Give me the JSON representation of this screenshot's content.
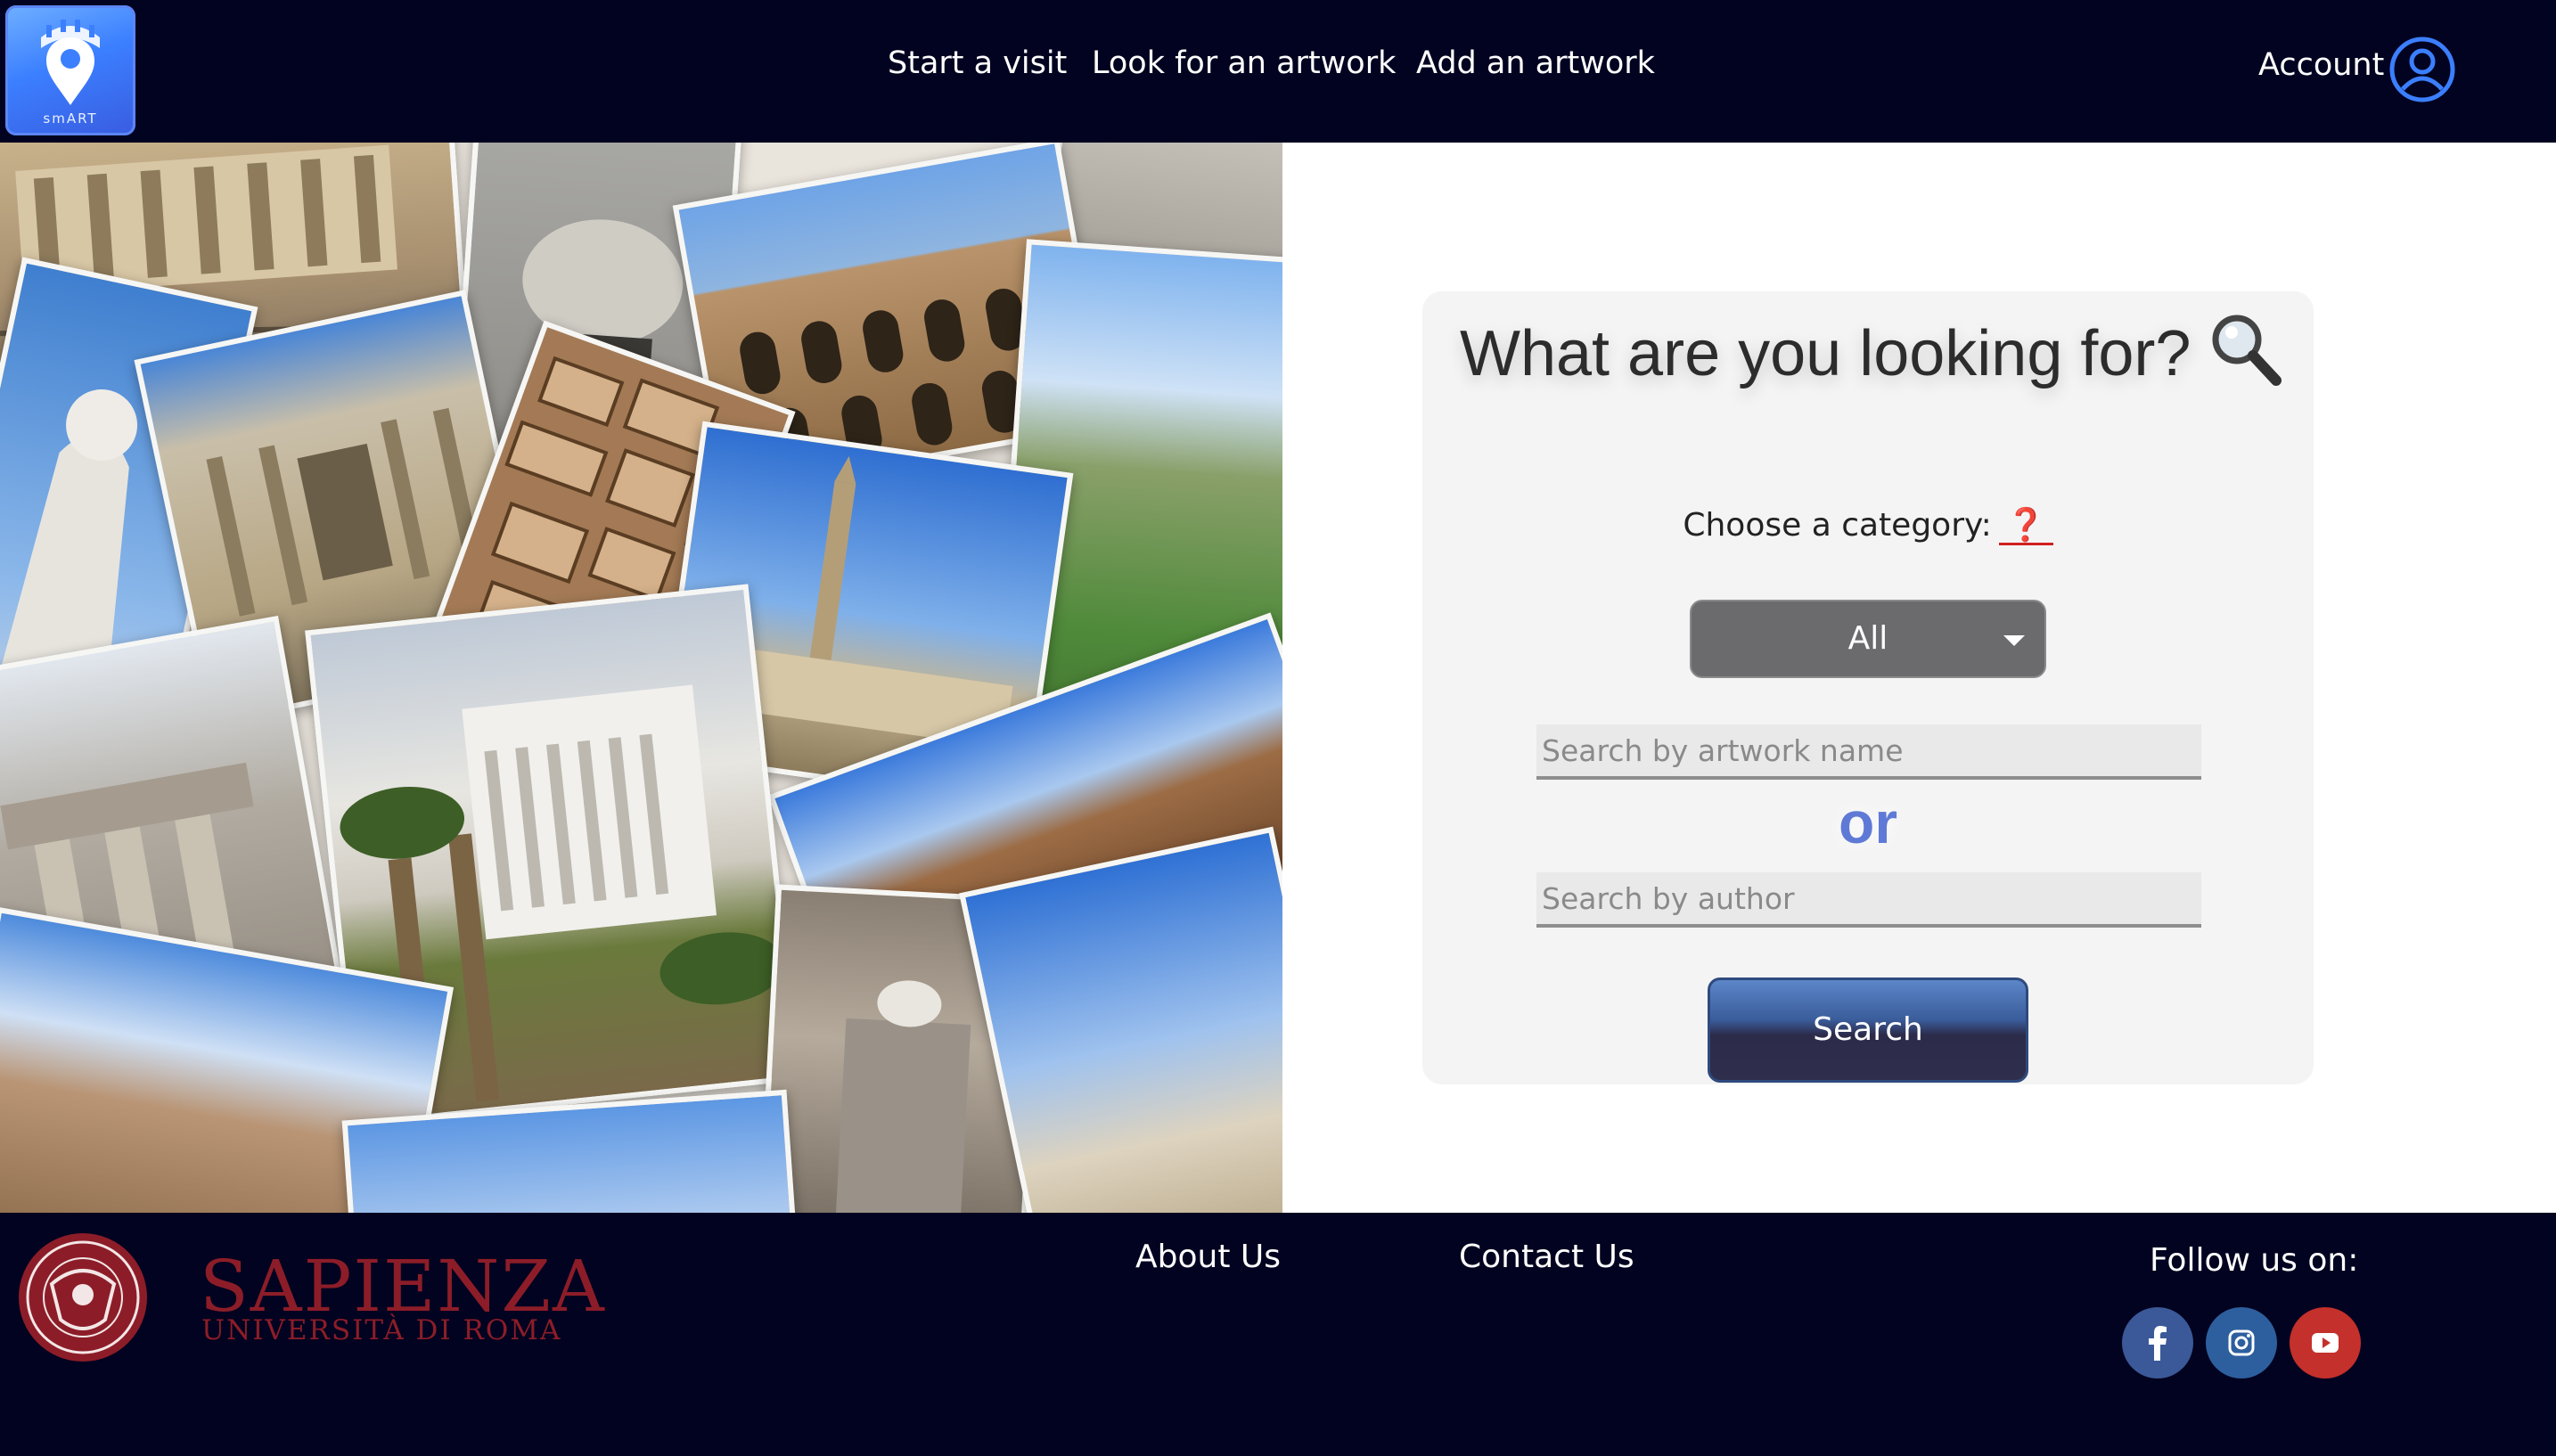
{
  "header": {
    "logo_text": "smART",
    "nav": [
      {
        "label": "Start a visit"
      },
      {
        "label": "Look for an artwork"
      },
      {
        "label": "Add an artwork"
      }
    ],
    "account_label": "Account"
  },
  "search": {
    "title": "What are you looking for?",
    "category_label": "Choose a category:",
    "help_icon": "❓",
    "category_selected": "All",
    "artwork_placeholder": "Search by artwork name",
    "or_label": "or",
    "author_placeholder": "Search by author",
    "search_button": "Search"
  },
  "footer": {
    "university_name": "Sapienza",
    "university_sub": "Università di Roma",
    "about": "About Us",
    "contact": "Contact Us",
    "follow_label": "Follow us on:"
  },
  "colors": {
    "header_bg": "#020320",
    "accent_blue": "#3b7fff",
    "sapienza_red": "#8c1d28",
    "facebook": "#3b5998",
    "instagram": "#2d5f9e",
    "youtube": "#c4302b"
  },
  "icons": [
    "logo-icon",
    "account-icon",
    "magnifier-icon",
    "help-icon",
    "caret-down-icon",
    "facebook-icon",
    "instagram-icon",
    "youtube-icon",
    "sapienza-seal-icon"
  ]
}
